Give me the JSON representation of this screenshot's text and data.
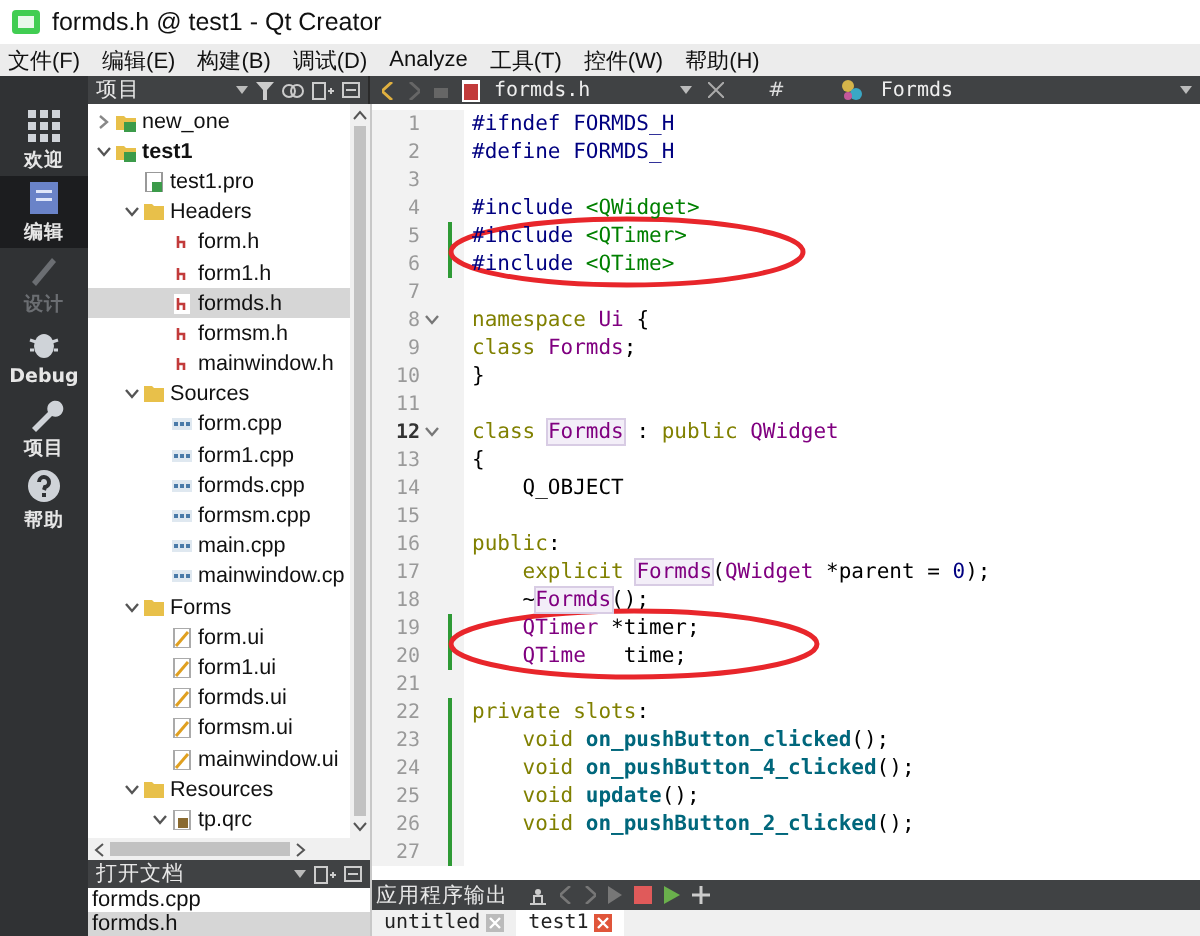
{
  "window": {
    "title": "formds.h @ test1 - Qt Creator"
  },
  "menu": [
    "文件(F)",
    "编辑(E)",
    "构建(B)",
    "调试(D)",
    "Analyze",
    "工具(T)",
    "控件(W)",
    "帮助(H)"
  ],
  "modes": [
    {
      "label": "欢迎",
      "kind": "welcome",
      "selected": false,
      "disabled": false
    },
    {
      "label": "编辑",
      "kind": "edit",
      "selected": true,
      "disabled": false
    },
    {
      "label": "设计",
      "kind": "design",
      "selected": false,
      "disabled": true
    },
    {
      "label": "Debug",
      "kind": "debug",
      "selected": false,
      "disabled": false
    },
    {
      "label": "项目",
      "kind": "projects",
      "selected": false,
      "disabled": false
    },
    {
      "label": "帮助",
      "kind": "help",
      "selected": false,
      "disabled": false
    }
  ],
  "project_panel": {
    "title": "项目",
    "tree": [
      {
        "label": "new_one",
        "kind": "project",
        "expanded": false,
        "active": false
      },
      {
        "label": "test1",
        "kind": "project",
        "expanded": true,
        "active": true,
        "children": [
          {
            "label": "test1.pro",
            "kind": "pro",
            "selected": false
          },
          {
            "label": "Headers",
            "kind": "folder",
            "expanded": true,
            "children": [
              {
                "label": "form.h",
                "kind": "h",
                "selected": false
              },
              {
                "label": "form1.h",
                "kind": "h",
                "selected": false
              },
              {
                "label": "formds.h",
                "kind": "h",
                "selected": true
              },
              {
                "label": "formsm.h",
                "kind": "h",
                "selected": false
              },
              {
                "label": "mainwindow.h",
                "kind": "h",
                "selected": false
              }
            ]
          },
          {
            "label": "Sources",
            "kind": "folder",
            "expanded": true,
            "children": [
              {
                "label": "form.cpp",
                "kind": "cpp",
                "selected": false
              },
              {
                "label": "form1.cpp",
                "kind": "cpp",
                "selected": false
              },
              {
                "label": "formds.cpp",
                "kind": "cpp",
                "selected": false
              },
              {
                "label": "formsm.cpp",
                "kind": "cpp",
                "selected": false
              },
              {
                "label": "main.cpp",
                "kind": "cpp",
                "selected": false
              },
              {
                "label": "mainwindow.cp",
                "kind": "cpp",
                "selected": false
              }
            ]
          },
          {
            "label": "Forms",
            "kind": "folder",
            "expanded": true,
            "children": [
              {
                "label": "form.ui",
                "kind": "ui",
                "selected": false
              },
              {
                "label": "form1.ui",
                "kind": "ui",
                "selected": false
              },
              {
                "label": "formds.ui",
                "kind": "ui",
                "selected": false
              },
              {
                "label": "formsm.ui",
                "kind": "ui",
                "selected": false
              },
              {
                "label": "mainwindow.ui",
                "kind": "ui",
                "selected": false
              }
            ]
          },
          {
            "label": "Resources",
            "kind": "folder",
            "expanded": true,
            "children": [
              {
                "label": "tp.qrc",
                "kind": "qrc",
                "expanded": true
              }
            ]
          }
        ]
      }
    ]
  },
  "open_documents": {
    "title": "打开文档",
    "items": [
      {
        "label": "formds.cpp",
        "selected": false
      },
      {
        "label": "formds.h",
        "selected": true
      }
    ]
  },
  "editor": {
    "file_tab": "formds.h",
    "symbol_hash": "#",
    "symbol": "Formds",
    "lines": [
      {
        "number": "1",
        "changed": false,
        "circled": false,
        "indented": false,
        "tokens": [
          {
            "kind": "pp",
            "text": "#ifndef FORMDS_H"
          }
        ]
      },
      {
        "number": "2",
        "changed": false,
        "circled": false,
        "indented": false,
        "tokens": [
          {
            "kind": "pp",
            "text": "#define FORMDS_H"
          }
        ]
      },
      {
        "number": "3",
        "changed": false,
        "circled": false
      },
      {
        "number": "4",
        "changed": false,
        "circled": false,
        "indented": false,
        "tokens": [
          {
            "kind": "pp",
            "text": "#include "
          },
          {
            "kind": "str",
            "text": "<QWidget>"
          }
        ]
      },
      {
        "number": "5",
        "changed": true,
        "circled": true,
        "indented": false,
        "tokens": [
          {
            "kind": "pp",
            "text": "#include "
          },
          {
            "kind": "str",
            "text": "<QTimer>"
          }
        ]
      },
      {
        "number": "6",
        "changed": true,
        "circled": true,
        "indented": false,
        "tokens": [
          {
            "kind": "pp",
            "text": "#include "
          },
          {
            "kind": "str",
            "text": "<QTime>"
          }
        ]
      },
      {
        "number": "7",
        "changed": false,
        "circled": false
      },
      {
        "number": "8",
        "changed": false,
        "circled": false,
        "foldable": true,
        "indented": false,
        "tokens": [
          {
            "kind": "kw",
            "text": "namespace "
          },
          {
            "kind": "type",
            "text": "Ui"
          },
          {
            "kind": "plain",
            "text": " {"
          }
        ]
      },
      {
        "number": "9",
        "changed": false,
        "circled": false,
        "indented": false,
        "tokens": [
          {
            "kind": "kw",
            "text": "class "
          },
          {
            "kind": "type",
            "text": "Formds"
          },
          {
            "kind": "plain",
            "text": ";"
          }
        ]
      },
      {
        "number": "10",
        "changed": false,
        "circled": false,
        "indented": false,
        "tokens": [
          {
            "kind": "plain",
            "text": "}"
          }
        ]
      },
      {
        "number": "11",
        "changed": false,
        "circled": false
      },
      {
        "number": "12",
        "changed": false,
        "circled": false,
        "foldable": true,
        "current": true,
        "indented": false,
        "tokens": [
          {
            "kind": "kw",
            "text": "class "
          },
          {
            "kind": "mark",
            "text": "Formds"
          },
          {
            "kind": "plain",
            "text": " : "
          },
          {
            "kind": "kw",
            "text": "public "
          },
          {
            "kind": "type",
            "text": "QWidget"
          }
        ]
      },
      {
        "number": "13",
        "changed": false,
        "circled": false,
        "indented": false,
        "tokens": [
          {
            "kind": "plain",
            "text": "{"
          }
        ]
      },
      {
        "number": "14",
        "changed": false,
        "circled": false,
        "indented": true,
        "tokens": [
          {
            "kind": "plain",
            "text": "Q_OBJECT"
          }
        ]
      },
      {
        "number": "15",
        "changed": false,
        "circled": false
      },
      {
        "number": "16",
        "changed": false,
        "circled": false,
        "indented": false,
        "tokens": [
          {
            "kind": "kw",
            "text": "public"
          },
          {
            "kind": "plain",
            "text": ":"
          }
        ]
      },
      {
        "number": "17",
        "changed": false,
        "circled": false,
        "indented": true,
        "tokens": [
          {
            "kind": "kw",
            "text": "explicit "
          },
          {
            "kind": "mark",
            "text": "Formds"
          },
          {
            "kind": "plain",
            "text": "("
          },
          {
            "kind": "type",
            "text": "QWidget"
          },
          {
            "kind": "plain",
            "text": " *parent = "
          },
          {
            "kind": "num",
            "text": "0"
          },
          {
            "kind": "plain",
            "text": ");"
          }
        ]
      },
      {
        "number": "18",
        "changed": false,
        "circled": false,
        "indented": true,
        "tokens": [
          {
            "kind": "plain",
            "text": "~"
          },
          {
            "kind": "mark",
            "text": "Formds"
          },
          {
            "kind": "plain",
            "text": "();"
          }
        ]
      },
      {
        "number": "19",
        "changed": true,
        "circled": true,
        "indented": true,
        "tokens": [
          {
            "kind": "type",
            "text": "QTimer"
          },
          {
            "kind": "plain",
            "text": " *timer;"
          }
        ]
      },
      {
        "number": "20",
        "changed": true,
        "circled": true,
        "indented": true,
        "tokens": [
          {
            "kind": "type",
            "text": "QTime"
          },
          {
            "kind": "plain",
            "text": "   time;"
          }
        ]
      },
      {
        "number": "21",
        "changed": false,
        "circled": false
      },
      {
        "number": "22",
        "changed": true,
        "circled": false,
        "indented": false,
        "tokens": [
          {
            "kind": "kw",
            "text": "private slots"
          },
          {
            "kind": "plain",
            "text": ":"
          }
        ]
      },
      {
        "number": "23",
        "changed": true,
        "circled": false,
        "indented": true,
        "tokens": [
          {
            "kind": "kw",
            "text": "void "
          },
          {
            "kind": "func",
            "text": "on_pushButton_clicked"
          },
          {
            "kind": "plain",
            "text": "();"
          }
        ]
      },
      {
        "number": "24",
        "changed": true,
        "circled": false,
        "indented": true,
        "tokens": [
          {
            "kind": "kw",
            "text": "void "
          },
          {
            "kind": "func",
            "text": "on_pushButton_4_clicked"
          },
          {
            "kind": "plain",
            "text": "();"
          }
        ]
      },
      {
        "number": "25",
        "changed": true,
        "circled": false,
        "indented": true,
        "tokens": [
          {
            "kind": "kw",
            "text": "void "
          },
          {
            "kind": "func",
            "text": "update"
          },
          {
            "kind": "plain",
            "text": "();"
          }
        ]
      },
      {
        "number": "26",
        "changed": true,
        "circled": false,
        "indented": true,
        "tokens": [
          {
            "kind": "kw",
            "text": "void "
          },
          {
            "kind": "func",
            "text": "on_pushButton_2_clicked"
          },
          {
            "kind": "plain",
            "text": "();"
          }
        ]
      },
      {
        "number": "27",
        "changed": true,
        "circled": false
      }
    ]
  },
  "output_pane": {
    "title": "应用程序输出",
    "tabs": [
      {
        "label": "untitled",
        "selected": false
      },
      {
        "label": "test1",
        "selected": true
      }
    ]
  }
}
